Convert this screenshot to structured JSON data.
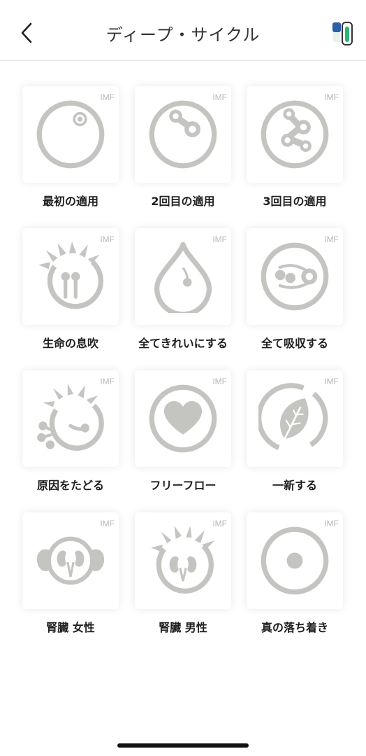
{
  "header": {
    "title": "ディープ・サイクル"
  },
  "tiles": [
    {
      "label": "最初の適用",
      "badge": "IMF",
      "icon": "circle-one-dot-icon"
    },
    {
      "label": "2回目の適用",
      "badge": "IMF",
      "icon": "circle-two-dots-icon"
    },
    {
      "label": "3回目の適用",
      "badge": "IMF",
      "icon": "circle-three-dots-icon"
    },
    {
      "label": "生命の息吹",
      "badge": "IMF",
      "icon": "spiky-sprout-icon"
    },
    {
      "label": "全てきれいにする",
      "badge": "IMF",
      "icon": "drop-icon"
    },
    {
      "label": "全て吸収する",
      "badge": "IMF",
      "icon": "absorb-icon"
    },
    {
      "label": "原因をたどる",
      "badge": "IMF",
      "icon": "trace-cause-icon"
    },
    {
      "label": "フリーフロー",
      "badge": "IMF",
      "icon": "heart-icon"
    },
    {
      "label": "一新する",
      "badge": "IMF",
      "icon": "leaf-icon"
    },
    {
      "label": "腎臓 女性",
      "badge": "IMF",
      "icon": "kidney-female-icon"
    },
    {
      "label": "腎臓 男性",
      "badge": "IMF",
      "icon": "kidney-male-icon"
    },
    {
      "label": "真の落ち着き",
      "badge": "IMF",
      "icon": "center-dot-icon"
    }
  ],
  "colors": {
    "icon": "#c4c5c1",
    "badge": "#b9bab6",
    "label": "#1f1f1f",
    "device_green": "#2bb673",
    "device_blue": "#2d5fa8"
  }
}
